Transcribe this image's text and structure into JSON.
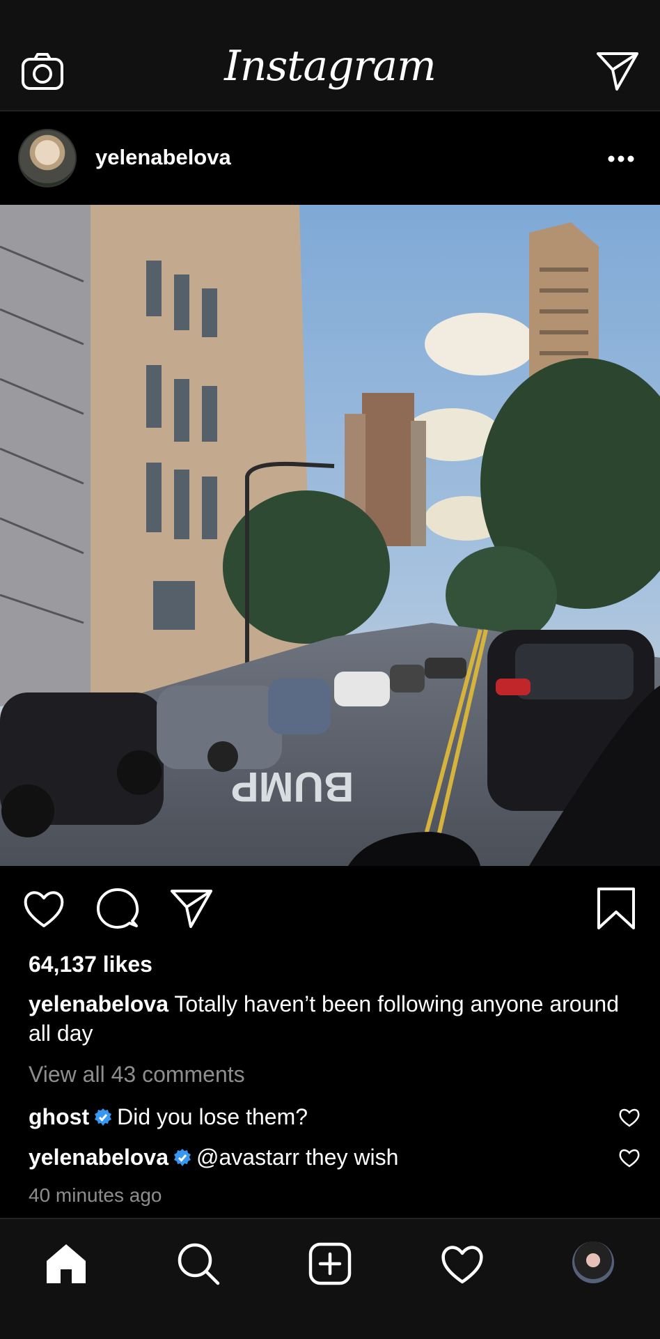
{
  "app": {
    "title": "Instagram"
  },
  "post": {
    "username": "yelenabelova",
    "likes": "64,137 likes",
    "caption_user": "yelenabelova",
    "caption_text": "Totally haven’t been following anyone around all day",
    "view_all": "View all 43 comments",
    "comments": [
      {
        "user": "ghost",
        "verified": true,
        "text": "Did you lose them?"
      },
      {
        "user": "yelenabelova",
        "verified": true,
        "text": "@avastarr they wish"
      }
    ],
    "time": "40 minutes ago",
    "photo_text": "BUMP"
  },
  "icons": {
    "top": [
      "camera-icon",
      "direct-send-icon"
    ],
    "actions": [
      "heart-icon",
      "comment-icon",
      "share-icon",
      "bookmark-icon"
    ],
    "nav": [
      "home-icon",
      "search-icon",
      "new-post-icon",
      "activity-heart-icon",
      "profile-avatar"
    ]
  },
  "colors": {
    "background": "#000000",
    "bar": "#111111",
    "muted": "#8e8e8e",
    "verified": "#3897f0"
  }
}
